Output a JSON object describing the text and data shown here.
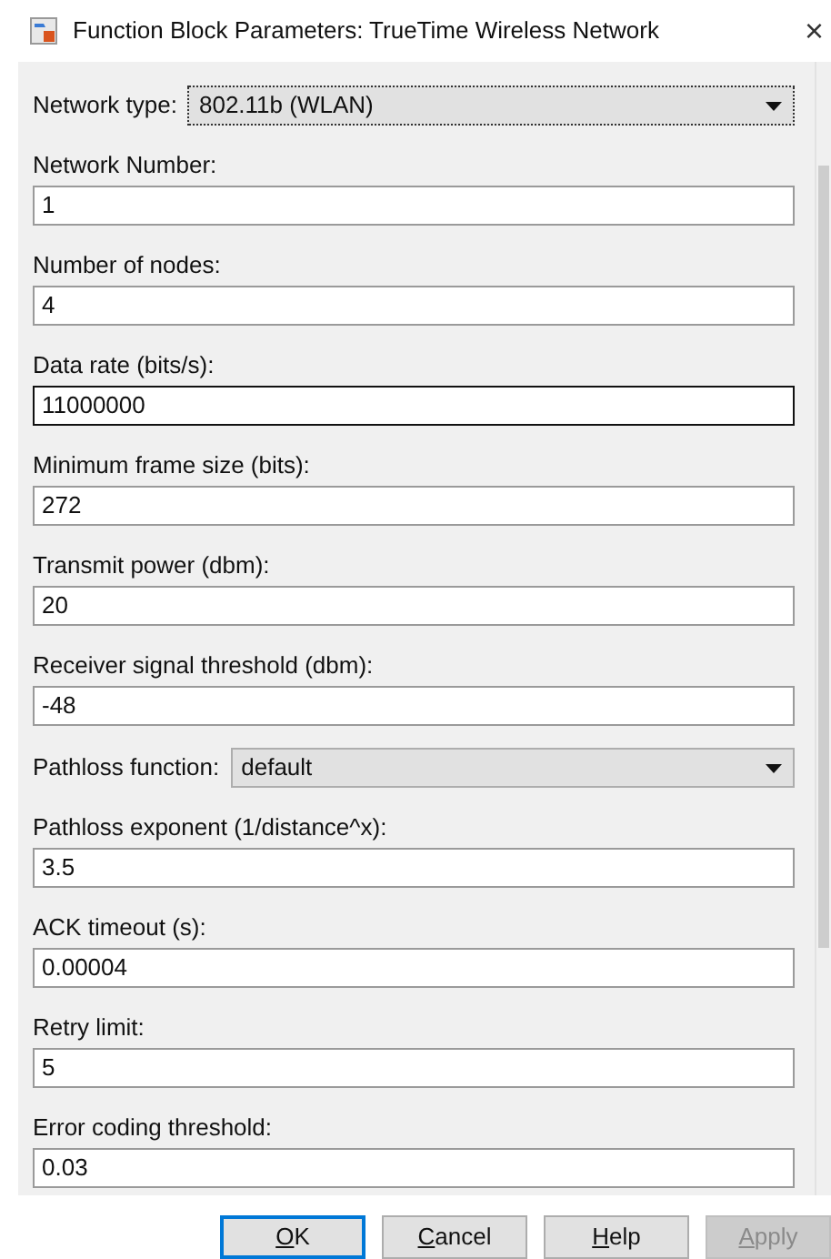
{
  "window": {
    "title": "Function Block Parameters: TrueTime Wireless Network",
    "close": "×"
  },
  "parameters": [
    {
      "kind": "dropdown",
      "label": "Network type:",
      "value": "802.11b (WLAN)",
      "focused": true
    },
    {
      "kind": "text",
      "label": "Network Number:",
      "value": "1",
      "focused": false
    },
    {
      "kind": "text",
      "label": "Number of nodes:",
      "value": "4",
      "focused": false
    },
    {
      "kind": "text",
      "label": "Data rate (bits/s):",
      "value": "11000000",
      "focused": true
    },
    {
      "kind": "text",
      "label": "Minimum frame size (bits):",
      "value": "272",
      "focused": false
    },
    {
      "kind": "text",
      "label": "Transmit power (dbm):",
      "value": "20",
      "focused": false
    },
    {
      "kind": "text",
      "label": "Receiver signal threshold (dbm):",
      "value": "-48",
      "focused": false
    },
    {
      "kind": "dropdown",
      "label": "Pathloss function:",
      "value": "default",
      "focused": false
    },
    {
      "kind": "text",
      "label": "Pathloss exponent (1/distance^x):",
      "value": "3.5",
      "focused": false
    },
    {
      "kind": "text",
      "label": "ACK timeout (s):",
      "value": "0.00004",
      "focused": false
    },
    {
      "kind": "text",
      "label": "Retry limit:",
      "value": "5",
      "focused": false
    },
    {
      "kind": "text",
      "label": "Error coding threshold:",
      "value": "0.03",
      "focused": false
    }
  ],
  "buttons": [
    {
      "label": "OK",
      "default": true,
      "disabled": false
    },
    {
      "label": "Cancel",
      "default": false,
      "disabled": false
    },
    {
      "label": "Help",
      "default": false,
      "disabled": false
    },
    {
      "label": "Apply",
      "default": false,
      "disabled": true
    }
  ]
}
